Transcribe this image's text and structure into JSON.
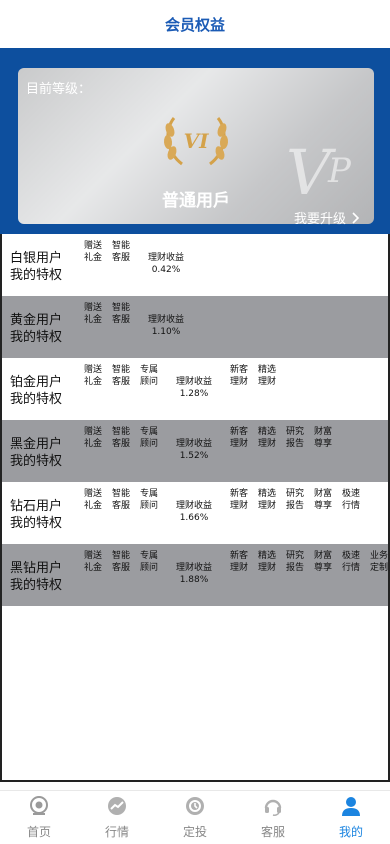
{
  "header": {
    "title": "会员权益"
  },
  "card": {
    "level_label": "目前等级：",
    "emblem_text": "VI",
    "level_name": "普通用戶",
    "upgrade_label": "我要升级"
  },
  "tiers": [
    {
      "name_line1": "白银用户",
      "name_line2": "我的特权",
      "gray": false,
      "items": [
        "赠送礼金",
        "智能客服"
      ],
      "yield_label": "理财收益",
      "yield_value": "0.42%",
      "extras": []
    },
    {
      "name_line1": "黄金用户",
      "name_line2": "我的特权",
      "gray": true,
      "items": [
        "赠送礼金",
        "智能客服"
      ],
      "yield_label": "理财收益",
      "yield_value": "1.10%",
      "extras": []
    },
    {
      "name_line1": "铂金用户",
      "name_line2": "我的特权",
      "gray": false,
      "items": [
        "赠送礼金",
        "智能客服",
        "专属顾问"
      ],
      "yield_label": "理财收益",
      "yield_value": "1.28%",
      "extras": [
        "新客理财",
        "精选理财"
      ]
    },
    {
      "name_line1": "黑金用户",
      "name_line2": "我的特权",
      "gray": true,
      "items": [
        "赠送礼金",
        "智能客服",
        "专属顾问"
      ],
      "yield_label": "理财收益",
      "yield_value": "1.52%",
      "extras": [
        "新客理财",
        "精选理财",
        "研究报告",
        "财富尊享"
      ]
    },
    {
      "name_line1": "钻石用户",
      "name_line2": "我的特权",
      "gray": false,
      "items": [
        "赠送礼金",
        "智能客服",
        "专属顾问"
      ],
      "yield_label": "理财收益",
      "yield_value": "1.66%",
      "extras": [
        "新客理财",
        "精选理财",
        "研究报告",
        "财富尊享",
        "极速行情"
      ]
    },
    {
      "name_line1": "黑钻用户",
      "name_line2": "我的特权",
      "gray": true,
      "items": [
        "赠送礼金",
        "智能客服",
        "专属顾问"
      ],
      "yield_label": "理财收益",
      "yield_value": "1.88%",
      "extras": [
        "新客理财",
        "精选理财",
        "研究报告",
        "财富尊享",
        "极速行情",
        "业务定制"
      ]
    }
  ],
  "tabbar": [
    {
      "label": "首页",
      "icon": "home-icon",
      "active": false
    },
    {
      "label": "行情",
      "icon": "market-icon",
      "active": false
    },
    {
      "label": "定投",
      "icon": "invest-icon",
      "active": false
    },
    {
      "label": "客服",
      "icon": "headset-icon",
      "active": false
    },
    {
      "label": "我的",
      "icon": "user-icon",
      "active": true
    }
  ],
  "colors": {
    "brand": "#0d4f9e",
    "accent": "#1b84e0",
    "row_gray": "#9b9ca0",
    "gold": "#d4a24a"
  }
}
